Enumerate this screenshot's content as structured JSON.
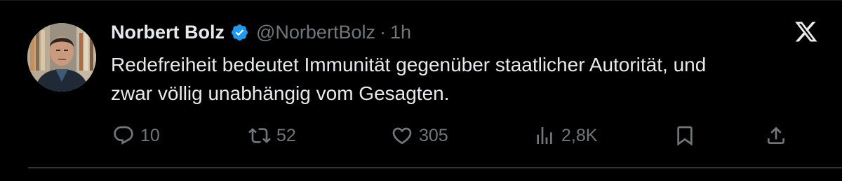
{
  "tweet": {
    "author": {
      "display_name": "Norbert Bolz",
      "handle": "@NorbertBolz",
      "verified": true,
      "avatar_icon": "profile-photo"
    },
    "separator": "·",
    "time": "1h",
    "text": "Redefreiheit bedeutet Immunität gegenüber staatlicher Autorität, und\nzwar völlig unabhängig vom Gesagten.",
    "actions": {
      "reply": {
        "icon": "reply-icon",
        "count": "10"
      },
      "retweet": {
        "icon": "retweet-icon",
        "count": "52"
      },
      "like": {
        "icon": "heart-icon",
        "count": "305"
      },
      "views": {
        "icon": "views-icon",
        "count": "2,8K"
      },
      "bookmark": {
        "icon": "bookmark-icon"
      },
      "share": {
        "icon": "share-icon"
      }
    }
  },
  "brand": {
    "logo_icon": "x-logo-icon"
  },
  "colors": {
    "background": "#000000",
    "text_primary": "#e7e9ea",
    "text_secondary": "#71767b",
    "verified_blue": "#1d9bf0",
    "divider": "#2f3336"
  }
}
